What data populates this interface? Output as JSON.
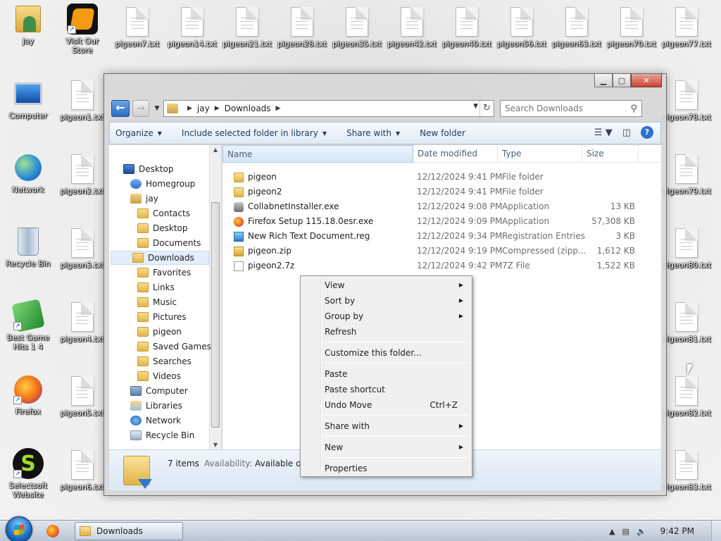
{
  "desktop": {
    "icons": [
      {
        "label": "jay",
        "icon": "user-folder-icon"
      },
      {
        "label": "Visit Our Store",
        "icon": "store-logo-icon"
      },
      {
        "label": "Computer",
        "icon": "computer-icon"
      },
      {
        "label": "Network",
        "icon": "network-icon"
      },
      {
        "label": "Recycle Bin",
        "icon": "recycle-bin-icon"
      },
      {
        "label": "Best Game Hits 1 4",
        "icon": "dice-icon"
      },
      {
        "label": "Firefox",
        "icon": "firefox-icon"
      },
      {
        "label": "Selectsoft Website",
        "icon": "selectsoft-icon"
      }
    ],
    "files_top": [
      "pigeon7.txt",
      "pigeon14.txt",
      "pigeon21.txt",
      "pigeon28.txt",
      "pigeon35.txt",
      "pigeon42.txt",
      "pigeon49.txt",
      "pigeon56.txt",
      "pigeon63.txt",
      "pigeon70.txt",
      "pigeon77.txt"
    ],
    "files_left": [
      "pigeon1.txt",
      "pigeon2.txt",
      "pigeon3.txt",
      "pigeon4.txt",
      "pigeon5.txt",
      "pigeon6.txt"
    ],
    "files_right": [
      "pigeon78.txt",
      "pigeon79.txt",
      "pigeon80.txt",
      "pigeon81.txt",
      "pigeon82.txt",
      "pigeon83.txt"
    ]
  },
  "explorer": {
    "caption": {
      "minimize": "▁",
      "maximize": "▢",
      "close": "✕"
    },
    "address": {
      "crumbs": [
        "jay",
        "Downloads"
      ]
    },
    "search": {
      "placeholder": "Search Downloads"
    },
    "toolbar": {
      "organize": "Organize",
      "include_library": "Include selected folder in library",
      "share_with": "Share with",
      "new_folder": "New folder"
    },
    "nav_tree": [
      {
        "label": "Desktop",
        "icon": "desktop-icon",
        "indent": 0
      },
      {
        "label": "Homegroup",
        "icon": "homegroup-icon",
        "indent": 1
      },
      {
        "label": "jay",
        "icon": "user-folder-icon",
        "indent": 1
      },
      {
        "label": "Contacts",
        "icon": "folder-icon",
        "indent": 2
      },
      {
        "label": "Desktop",
        "icon": "folder-icon",
        "indent": 2
      },
      {
        "label": "Documents",
        "icon": "folder-icon",
        "indent": 2
      },
      {
        "label": "Downloads",
        "icon": "folder-icon",
        "indent": 2,
        "selected": true
      },
      {
        "label": "Favorites",
        "icon": "folder-icon",
        "indent": 2
      },
      {
        "label": "Links",
        "icon": "folder-icon",
        "indent": 2
      },
      {
        "label": "Music",
        "icon": "folder-icon",
        "indent": 2
      },
      {
        "label": "Pictures",
        "icon": "folder-icon",
        "indent": 2
      },
      {
        "label": "pigeon",
        "icon": "folder-icon",
        "indent": 2
      },
      {
        "label": "Saved Games",
        "icon": "folder-icon",
        "indent": 2
      },
      {
        "label": "Searches",
        "icon": "folder-icon",
        "indent": 2
      },
      {
        "label": "Videos",
        "icon": "folder-icon",
        "indent": 2
      },
      {
        "label": "Computer",
        "icon": "computer-icon",
        "indent": 1
      },
      {
        "label": "Libraries",
        "icon": "libraries-icon",
        "indent": 1
      },
      {
        "label": "Network",
        "icon": "network-icon",
        "indent": 1
      },
      {
        "label": "Recycle Bin",
        "icon": "recycle-bin-icon",
        "indent": 1
      }
    ],
    "columns": {
      "name": "Name",
      "date": "Date modified",
      "type": "Type",
      "size": "Size"
    },
    "files": [
      {
        "name": "pigeon",
        "date": "12/12/2024 9:41 PM",
        "type": "File folder",
        "size": "",
        "icon": "folder-icon"
      },
      {
        "name": "pigeon2",
        "date": "12/12/2024 9:41 PM",
        "type": "File folder",
        "size": "",
        "icon": "folder-icon"
      },
      {
        "name": "CollabnetInstaller.exe",
        "date": "12/12/2024 9:08 PM",
        "type": "Application",
        "size": "13 KB",
        "icon": "installer-icon"
      },
      {
        "name": "Firefox Setup 115.18.0esr.exe",
        "date": "12/12/2024 9:09 PM",
        "type": "Application",
        "size": "57,308 KB",
        "icon": "firefox-icon"
      },
      {
        "name": "New Rich Text Document.reg",
        "date": "12/12/2024 9:34 PM",
        "type": "Registration Entries",
        "size": "3 KB",
        "icon": "registry-icon"
      },
      {
        "name": "pigeon.zip",
        "date": "12/12/2024 9:19 PM",
        "type": "Compressed (zipp...",
        "size": "1,612 KB",
        "icon": "zip-folder-icon"
      },
      {
        "name": "pigeon2.7z",
        "date": "12/12/2024 9:42 PM",
        "type": "7Z File",
        "size": "1,522 KB",
        "icon": "file-icon"
      }
    ],
    "details": {
      "count": "7 items",
      "availability_label": "Availability:",
      "availability_value": "Available offli"
    }
  },
  "context_menu": {
    "items": [
      {
        "label": "View",
        "submenu": true
      },
      {
        "label": "Sort by",
        "submenu": true
      },
      {
        "label": "Group by",
        "submenu": true
      },
      {
        "label": "Refresh"
      },
      {
        "separator": true
      },
      {
        "label": "Customize this folder..."
      },
      {
        "separator": true
      },
      {
        "label": "Paste"
      },
      {
        "label": "Paste shortcut"
      },
      {
        "label": "Undo Move",
        "accel": "Ctrl+Z"
      },
      {
        "separator": true
      },
      {
        "label": "Share with",
        "submenu": true
      },
      {
        "separator": true
      },
      {
        "label": "New",
        "submenu": true
      },
      {
        "separator": true
      },
      {
        "label": "Properties"
      }
    ]
  },
  "taskbar": {
    "active_window": "Downloads",
    "clock": "9:42 PM"
  }
}
